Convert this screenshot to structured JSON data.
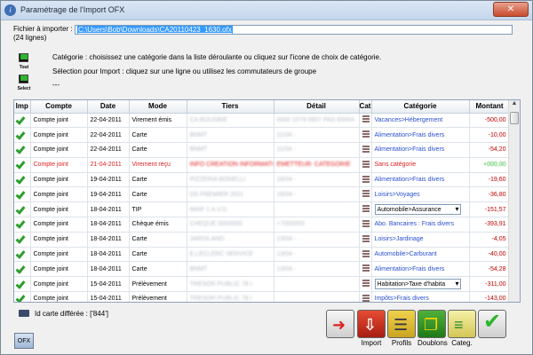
{
  "window": {
    "title": "Paramétrage de l'Import OFX",
    "close_label": "✕",
    "colors": {
      "title_bar": "#c5d6ec",
      "close": "#c94a2c",
      "link_blue": "#2a4fd0",
      "error_red": "#e02020",
      "amount_red": "#c00000"
    }
  },
  "file": {
    "label": "Fichier à importer :",
    "count": "(24 lignes)",
    "path": "C:\\Users\\Bob\\Downloads\\CA20110423_1630.ofx"
  },
  "tools": {
    "tout_label": "Tout",
    "select_label": "Select"
  },
  "info": {
    "line1": "Catégorie : choisissez une catégorie dans la liste déroulante ou cliquez sur l'icone de choix de catégorie.",
    "line2": "Sélection pour Import : cliquez sur une ligne ou utilisez les commutateurs de groupe",
    "line3": "---"
  },
  "table": {
    "headers": [
      "Imp",
      "Compte",
      "Date",
      "Mode",
      "Tiers",
      "Détail",
      "Cat",
      "Catégorie",
      "Montant"
    ],
    "rows": [
      {
        "compte": "Compte joint",
        "date": "22-04-2011",
        "mode": "Virement émis",
        "tiers": "CA BOUSBIE",
        "detail": "0000 1079 0607 PAS ERRA",
        "categorie": "Vacances>Hébergement",
        "montant": "-500,00",
        "combo": false,
        "error": false
      },
      {
        "compte": "Compte joint",
        "date": "22-04-2011",
        "mode": "Carte",
        "tiers": "BNMT",
        "detail": "11/04 -",
        "categorie": "Alimentation>Frais divers",
        "montant": "-10,00",
        "combo": false,
        "error": false
      },
      {
        "compte": "Compte joint",
        "date": "22-04-2011",
        "mode": "Carte",
        "tiers": "BNMT",
        "detail": "11/04 -",
        "categorie": "Alimentation>Frais divers",
        "montant": "-54,20",
        "combo": false,
        "error": false
      },
      {
        "compte": "Compte joint",
        "date": "21-04-2011",
        "mode": "Virement reçu",
        "tiers": "INFO CREATION INFORMATIQUE",
        "detail": "EMETTEUR: CATEGORIE",
        "categorie": "Sans catégorie",
        "montant": "+000,00",
        "combo": false,
        "error": true
      },
      {
        "compte": "Compte joint",
        "date": "19-04-2011",
        "mode": "Carte",
        "tiers": "PIZZERIA BONELLI",
        "detail": "16/04 -",
        "categorie": "Alimentation>Frais divers",
        "montant": "-19,60",
        "combo": false,
        "error": false
      },
      {
        "compte": "Compte joint",
        "date": "19-04-2011",
        "mode": "Carte",
        "tiers": "DS PREMIER 2011",
        "detail": "16/04 -",
        "categorie": "Loisirs>Voyages",
        "montant": "-36,80",
        "combo": false,
        "error": false
      },
      {
        "compte": "Compte joint",
        "date": "18-04-2011",
        "mode": "TIP",
        "tiers": "MAIF 1 A.V.D",
        "detail": "",
        "categorie": "Automobile>Assurance",
        "montant": "-151,57",
        "combo": true,
        "error": false
      },
      {
        "compte": "Compte joint",
        "date": "18-04-2011",
        "mode": "Chèque émis",
        "tiers": "CHEQUE 0000000",
        "detail": "+7000000",
        "categorie": "Abo. Bancaires : Frais divers",
        "montant": "-393,91",
        "combo": false,
        "error": false
      },
      {
        "compte": "Compte joint",
        "date": "18-04-2011",
        "mode": "Carte",
        "tiers": "JARDILAND",
        "detail": "13/04 -",
        "categorie": "Loisirs>Jardinage",
        "montant": "-4,05",
        "combo": false,
        "error": false
      },
      {
        "compte": "Compte joint",
        "date": "18-04-2011",
        "mode": "Carte",
        "tiers": "E.LECLERC SERVICE",
        "detail": "13/04 -",
        "categorie": "Automobile>Carburant",
        "montant": "-40,00",
        "combo": false,
        "error": false
      },
      {
        "compte": "Compte joint",
        "date": "18-04-2011",
        "mode": "Carte",
        "tiers": "BNMT",
        "detail": "13/04 -",
        "categorie": "Alimentation>Frais divers",
        "montant": "-54,28",
        "combo": false,
        "error": false
      },
      {
        "compte": "Compte joint",
        "date": "15-04-2011",
        "mode": "Prélèvement",
        "tiers": "TRESOR PUBLIC 78 I",
        "detail": "",
        "categorie": "Habitation>Taxe d'habita",
        "montant": "-311,00",
        "combo": true,
        "error": false
      },
      {
        "compte": "Compte joint",
        "date": "15-04-2011",
        "mode": "Prélèvement",
        "tiers": "TRESOR PUBLIC 78 I",
        "detail": "",
        "categorie": "Impôts>Frais divers",
        "montant": "-143,00",
        "combo": false,
        "error": false
      }
    ]
  },
  "card_info": "Id carte différée : ['844']",
  "toolbar": {
    "import_label": "Import",
    "profils_label": "Profils",
    "doublons_label": "Doublons",
    "categ_label": "Categ."
  }
}
